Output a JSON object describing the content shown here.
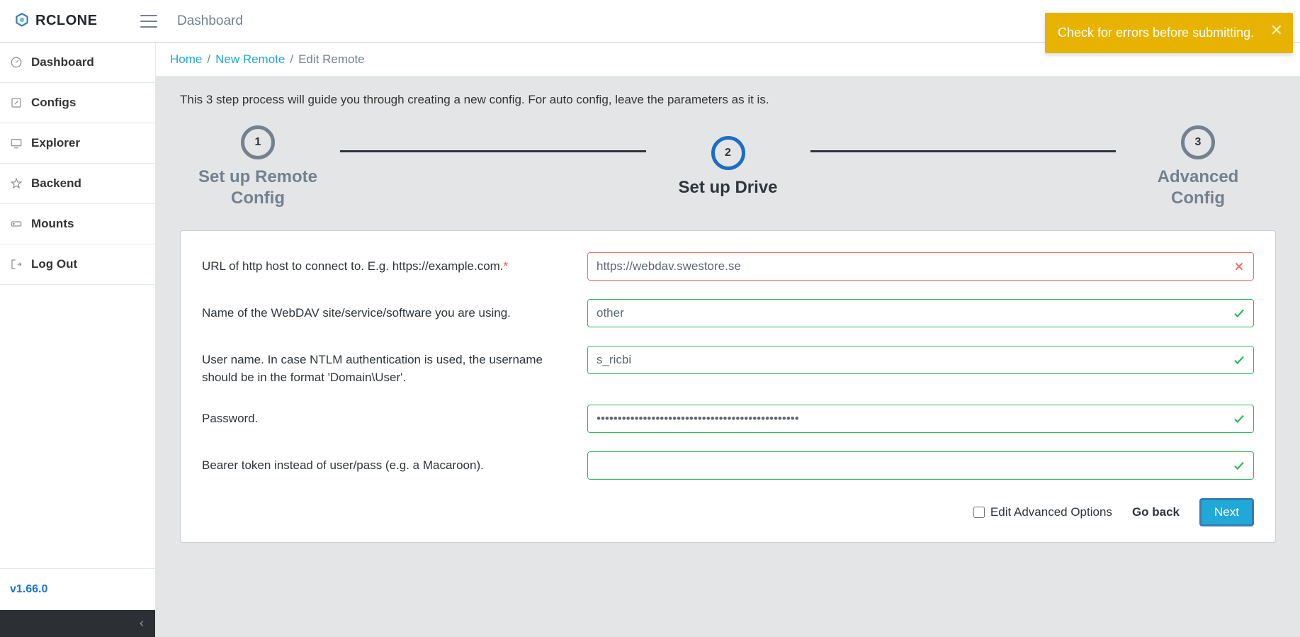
{
  "app": {
    "name": "RCLONE"
  },
  "topbar": {
    "title": "Dashboard"
  },
  "toast": {
    "message": "Check for errors before submitting."
  },
  "sidebar": {
    "items": [
      {
        "label": "Dashboard",
        "icon": "gauge"
      },
      {
        "label": "Configs",
        "icon": "pencil-square"
      },
      {
        "label": "Explorer",
        "icon": "monitor"
      },
      {
        "label": "Backend",
        "icon": "star"
      },
      {
        "label": "Mounts",
        "icon": "drive"
      },
      {
        "label": "Log Out",
        "icon": "logout"
      }
    ],
    "version": "v1.66.0"
  },
  "breadcrumb": {
    "items": [
      {
        "label": "Home",
        "link": true
      },
      {
        "label": "New Remote",
        "link": true
      },
      {
        "label": "Edit Remote",
        "link": false
      }
    ]
  },
  "intro": "This 3 step process will guide you through creating a new config. For auto config, leave the parameters as it is.",
  "stepper": {
    "steps": [
      {
        "num": "1",
        "label": "Set up Remote\nConfig",
        "active": false
      },
      {
        "num": "2",
        "label": "Set up Drive",
        "active": true
      },
      {
        "num": "3",
        "label": "Advanced\nConfig",
        "active": false
      }
    ]
  },
  "form": {
    "fields": [
      {
        "label": "URL of http host to connect to. E.g. https://example.com.",
        "required": true,
        "value": "https://webdav.swestore.se",
        "valid": false,
        "name": "url-input",
        "type": "text"
      },
      {
        "label": "Name of the WebDAV site/service/software you are using.",
        "required": false,
        "value": "other",
        "valid": true,
        "name": "vendor-input",
        "type": "text"
      },
      {
        "label": "User name. In case NTLM authentication is used, the username should be in the format 'Domain\\User'.",
        "required": false,
        "value": "s_ricbi",
        "valid": true,
        "name": "username-input",
        "type": "text"
      },
      {
        "label": "Password.",
        "required": false,
        "value": "************************************************",
        "valid": true,
        "name": "password-input",
        "type": "password"
      },
      {
        "label": "Bearer token instead of user/pass (e.g. a Macaroon).",
        "required": false,
        "value": "",
        "valid": true,
        "name": "bearer-token-input",
        "type": "text"
      }
    ],
    "advanced_label": "Edit Advanced Options",
    "back_label": "Go back",
    "next_label": "Next"
  }
}
